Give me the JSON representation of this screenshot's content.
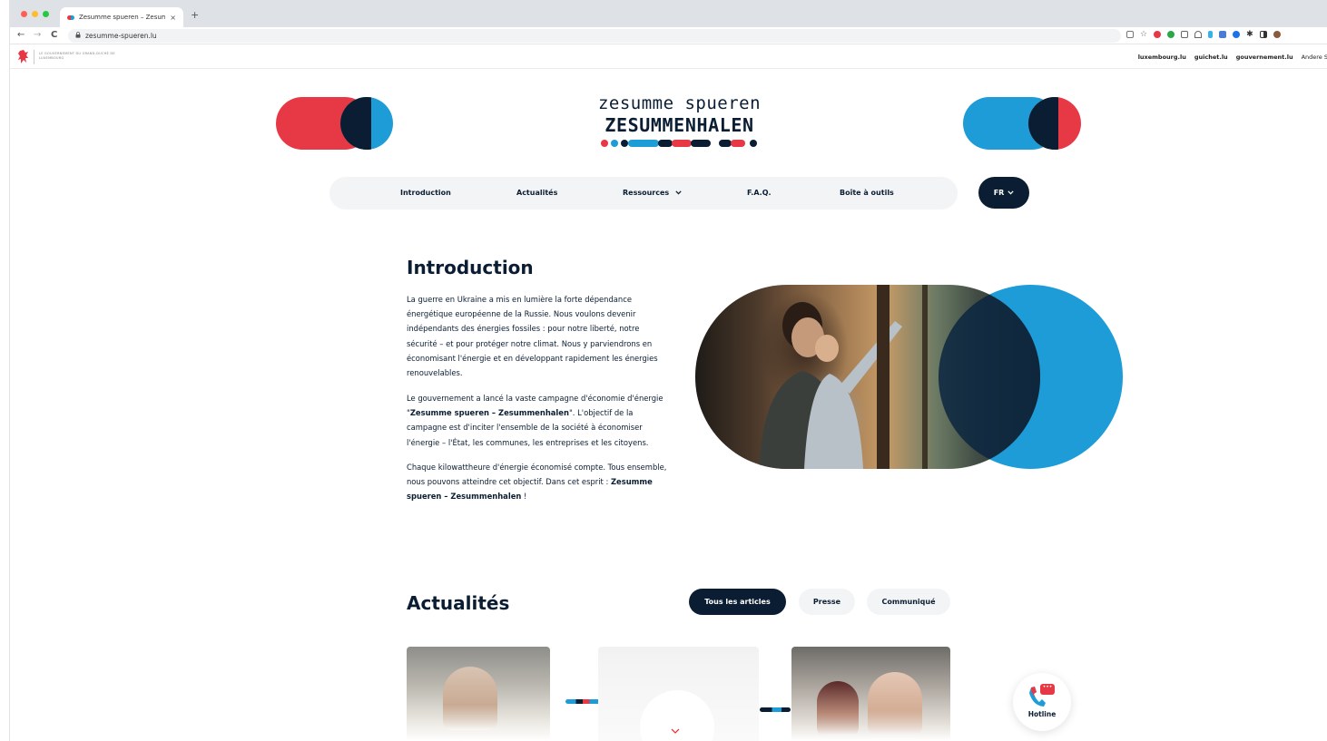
{
  "browser": {
    "tab_title": "Zesumme spueren – Zesumm",
    "tab_close": "×",
    "new_tab": "+",
    "url": "zesumme-spueren.lu",
    "back": "←",
    "forward": "→",
    "reload": "C",
    "lock": "🔒"
  },
  "govbar": {
    "logo_text": "LE GOUVERNEMENT DU GRAND-DUCHÉ DE LUXEMBOURG",
    "links": [
      "luxembourg.lu",
      "guichet.lu",
      "gouvernement.lu",
      "Andere S"
    ]
  },
  "logo": {
    "line1": "zesumme spueren",
    "line2": "ZESUMMENHALEN"
  },
  "nav": {
    "items": [
      "Introduction",
      "Actualités",
      "Ressources",
      "F.A.Q.",
      "Boîte à outils"
    ],
    "ressources_chevron": "⌄",
    "lang": "FR",
    "lang_chevron": "⌄"
  },
  "intro": {
    "title": "Introduction",
    "p1": "La guerre en Ukraine a mis en lumière la forte dépendance énergétique européenne de la Russie. Nous voulons devenir indépendants des énergies fossiles : pour notre liberté, notre sécurité – et pour protéger notre climat. Nous y parviendrons en économisant l'énergie et en développant rapidement les énergies renouvelables.",
    "p2_a": "Le gouvernement a lancé la vaste campagne d'économie d'énergie \"",
    "p2_b": "Zesumme spueren – Zesummenhalen",
    "p2_c": "\". L'objectif de la campagne est d'inciter l'ensemble de la société à économiser l'énergie – l'État, les communes, les entreprises et les citoyens.",
    "p3_a": "Chaque kilowattheure d'énergie économisé compte. Tous ensemble, nous pouvons atteindre cet objectif. Dans cet esprit : ",
    "p3_b": "Zesumme spueren – Zesummenhalen",
    "p3_c": " !"
  },
  "news": {
    "title": "Actualités",
    "filters": [
      "Tous les articles",
      "Presse",
      "Communiqué"
    ]
  },
  "hotline": {
    "label": "Hotline",
    "bubble": "•••"
  },
  "colors": {
    "red": "#e73845",
    "blue": "#1e9cd7",
    "navy": "#0b1d33"
  }
}
